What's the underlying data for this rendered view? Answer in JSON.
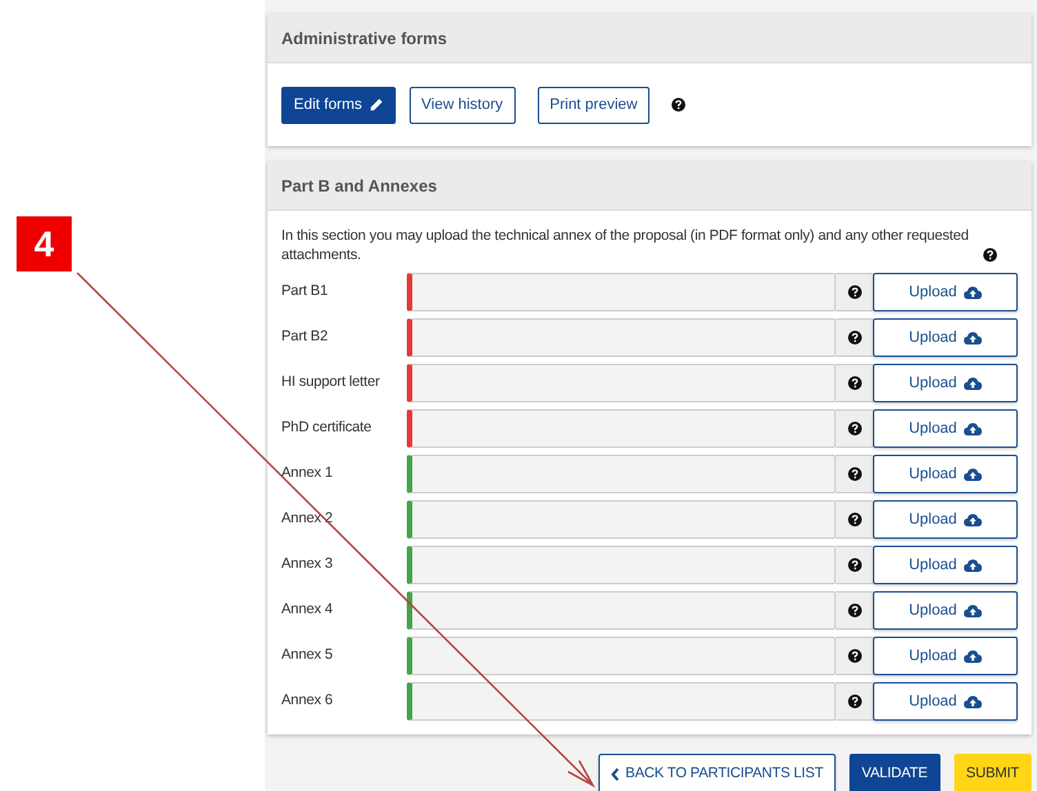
{
  "annotation": {
    "label": "4"
  },
  "admin_forms": {
    "title": "Administrative forms",
    "buttons": [
      {
        "label": "Edit forms",
        "kind": "primary"
      },
      {
        "label": "View history",
        "kind": "outline"
      },
      {
        "label": "Print preview",
        "kind": "outline"
      }
    ]
  },
  "part_b": {
    "title": "Part B and Annexes",
    "intro": "In this section you may upload the technical annex of the proposal (in PDF format only) and any other requested attachments.",
    "rows": [
      {
        "label": "Part B1",
        "required": true,
        "button": "Upload"
      },
      {
        "label": "Part B2",
        "required": true,
        "button": "Upload"
      },
      {
        "label": "HI support letter",
        "required": true,
        "button": "Upload"
      },
      {
        "label": "PhD certificate",
        "required": true,
        "button": "Upload"
      },
      {
        "label": "Annex 1",
        "required": false,
        "button": "Upload"
      },
      {
        "label": "Annex 2",
        "required": false,
        "button": "Upload"
      },
      {
        "label": "Annex 3",
        "required": false,
        "button": "Upload"
      },
      {
        "label": "Annex 4",
        "required": false,
        "button": "Upload"
      },
      {
        "label": "Annex 5",
        "required": false,
        "button": "Upload"
      },
      {
        "label": "Annex 6",
        "required": false,
        "button": "Upload"
      }
    ]
  },
  "footer": {
    "buttons": [
      {
        "label": "BACK TO PARTICIPANTS LIST",
        "kind": "back"
      },
      {
        "label": "VALIDATE",
        "kind": "primary"
      },
      {
        "label": "SUBMIT",
        "kind": "warning"
      }
    ]
  }
}
